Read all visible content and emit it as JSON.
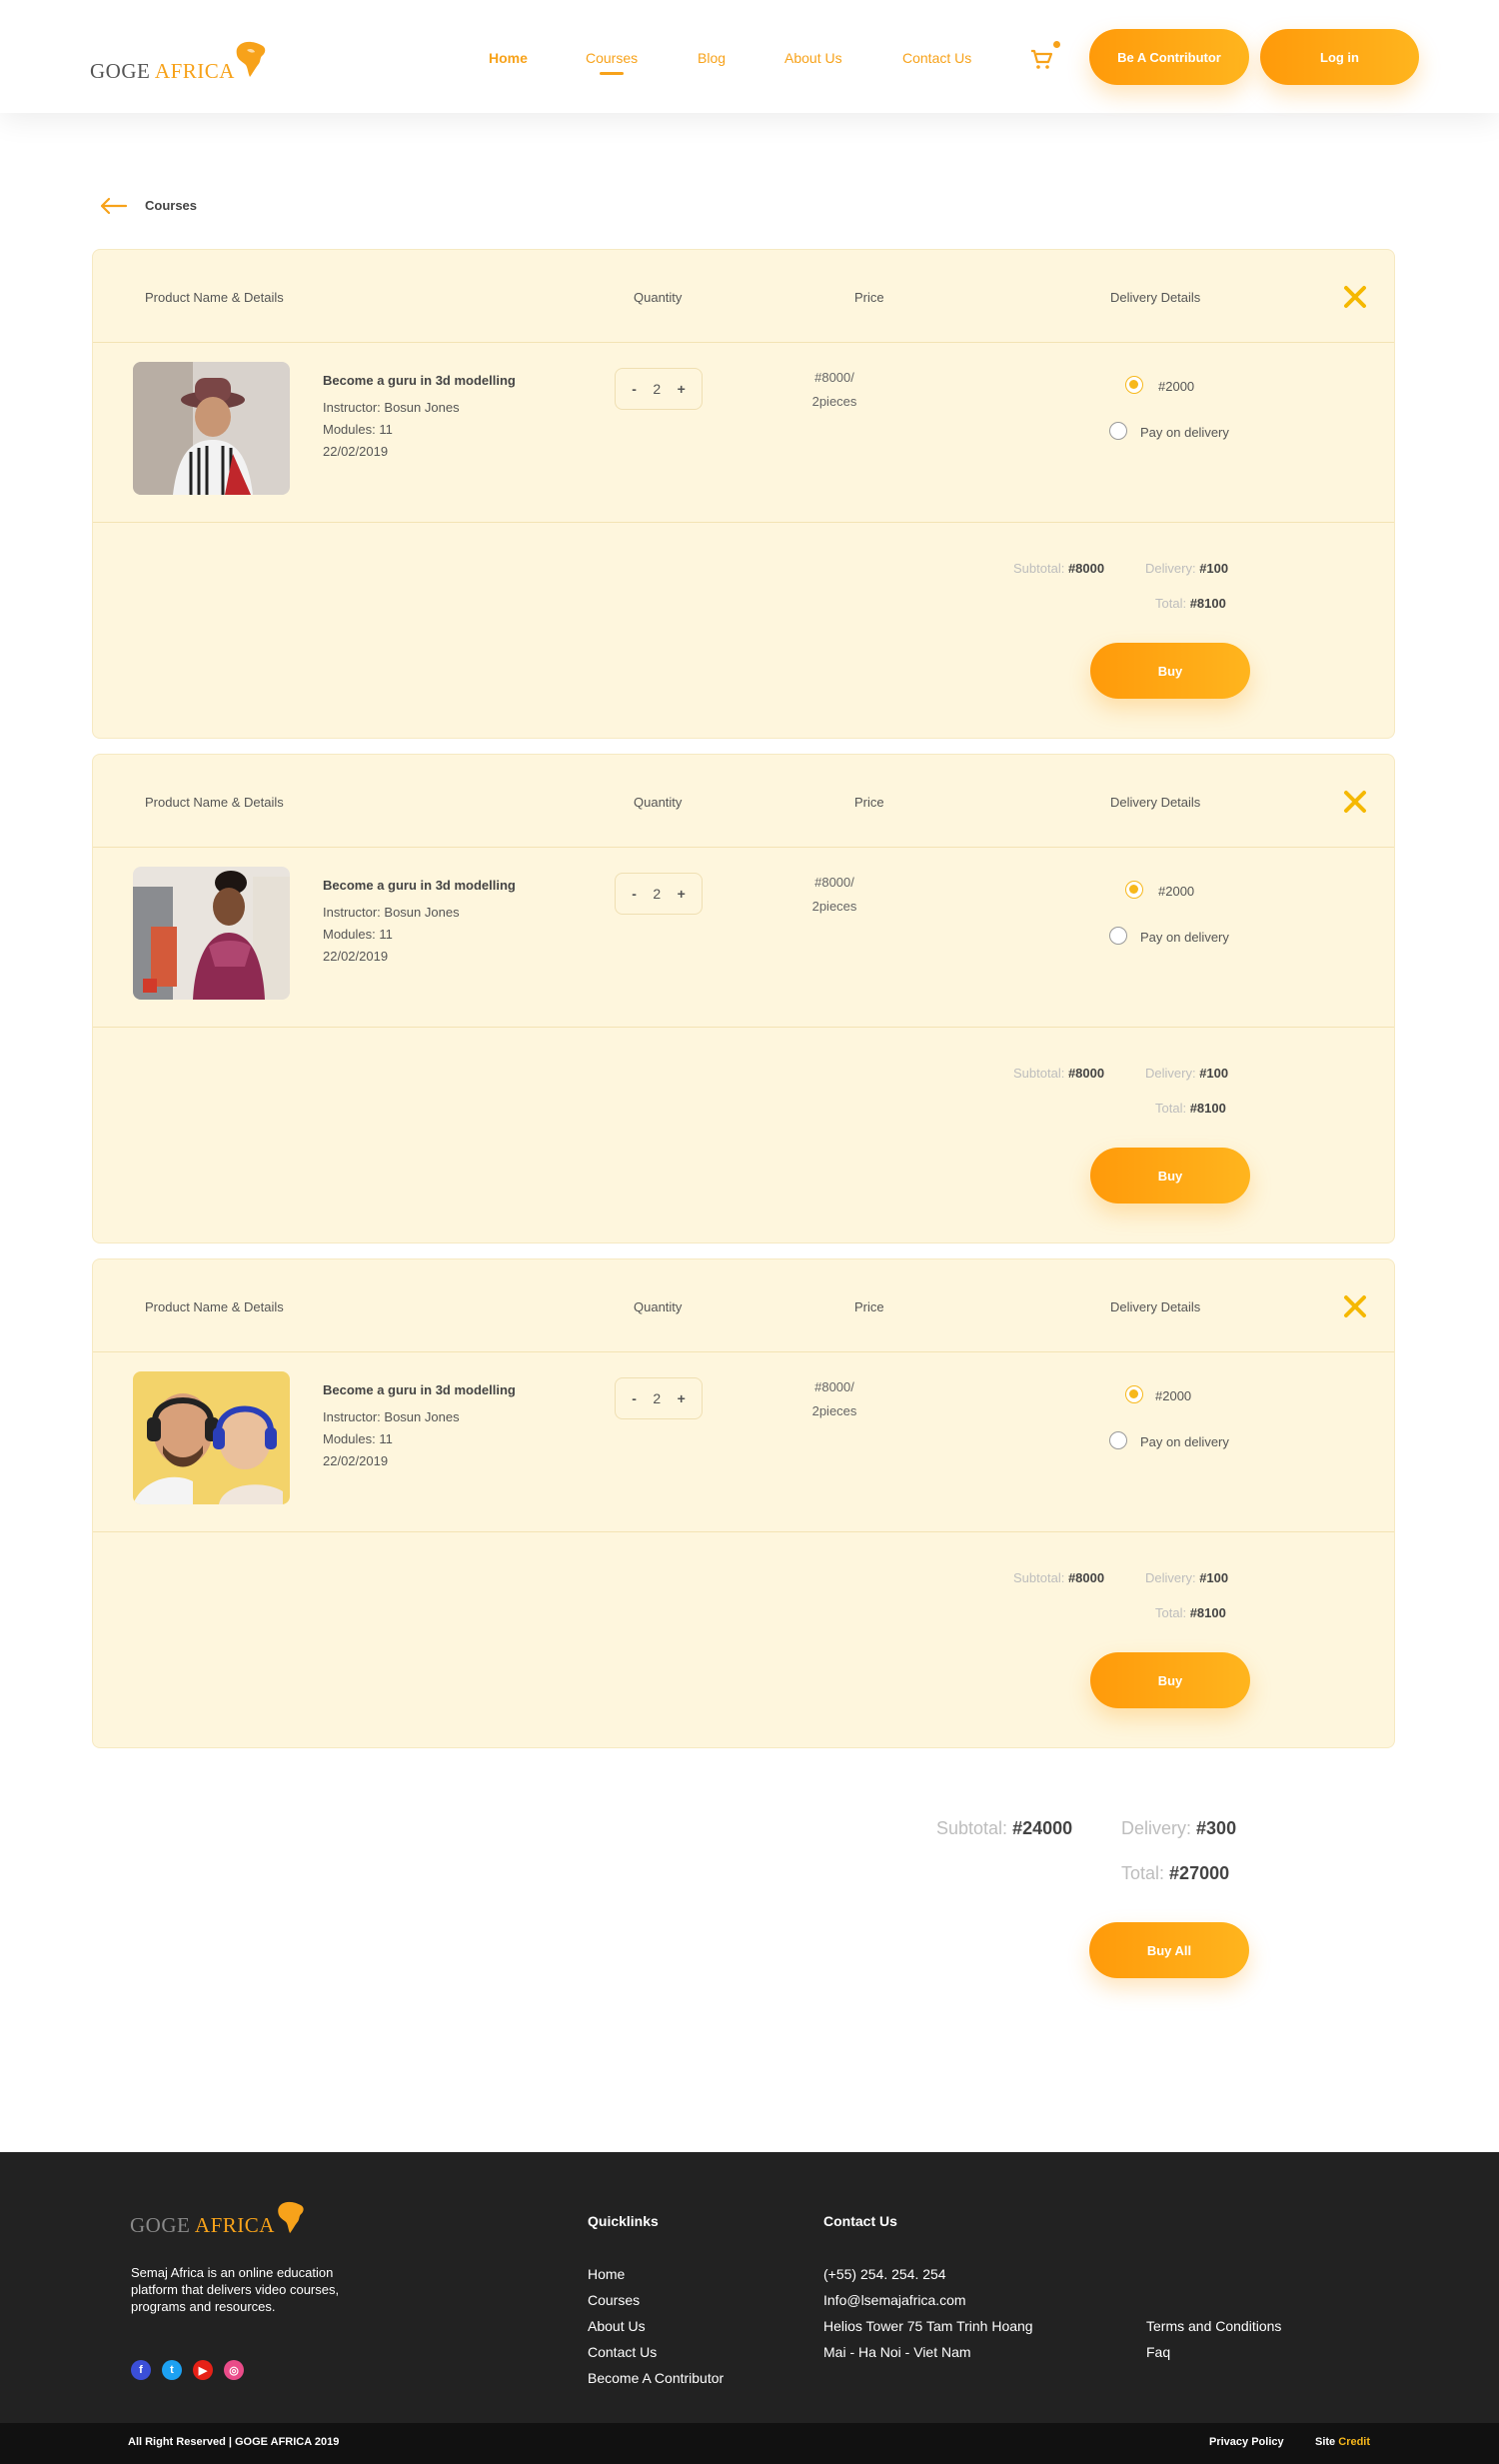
{
  "brand": {
    "name_part1": "GOGE",
    "name_part2": "AFRICA"
  },
  "nav": {
    "home": "Home",
    "courses": "Courses",
    "blog": "Blog",
    "about": "About Us",
    "contact": "Contact Us",
    "contributor_btn": "Be A Contributor",
    "login_btn": "Log in"
  },
  "breadcrumb": {
    "label": "Courses"
  },
  "table_headers": {
    "product": "Product Name & Details",
    "quantity": "Quantity",
    "price": "Price",
    "delivery": "Delivery Details"
  },
  "cart_items": [
    {
      "title": "Become a guru in 3d modelling",
      "instructor": "Instructor: Bosun Jones",
      "modules": "Modules: 11",
      "date": "22/02/2019",
      "qty_minus": "-",
      "qty": "2",
      "qty_plus": "+",
      "price_line1": "#8000/",
      "price_line2": "2pieces",
      "delivery_option1": "#2000",
      "delivery_option2": "Pay on delivery",
      "subtotal_label": "Subtotal:",
      "subtotal": "#8000",
      "delivery_label": "Delivery:",
      "delivery": "#100",
      "total_label": "Total:",
      "total": "#8100",
      "buy": "Buy"
    },
    {
      "title": "Become a guru in 3d modelling",
      "instructor": "Instructor: Bosun Jones",
      "modules": "Modules: 11",
      "date": "22/02/2019",
      "qty_minus": "-",
      "qty": "2",
      "qty_plus": "+",
      "price_line1": "#8000/",
      "price_line2": "2pieces",
      "delivery_option1": "#2000",
      "delivery_option2": "Pay on delivery",
      "subtotal_label": "Subtotal:",
      "subtotal": "#8000",
      "delivery_label": "Delivery:",
      "delivery": "#100",
      "total_label": "Total:",
      "total": "#8100",
      "buy": "Buy"
    },
    {
      "title": "Become a guru in 3d modelling",
      "instructor": "Instructor: Bosun Jones",
      "modules": "Modules: 11",
      "date": "22/02/2019",
      "qty_minus": "-",
      "qty": "2",
      "qty_plus": "+",
      "price_line1": "#8000/",
      "price_line2": "2pieces",
      "delivery_option1": "#2000",
      "delivery_option2": "Pay on delivery",
      "subtotal_label": "Subtotal:",
      "subtotal": "#8000",
      "delivery_label": "Delivery:",
      "delivery": "#100",
      "total_label": "Total:",
      "total": "#8100",
      "buy": "Buy"
    }
  ],
  "summary": {
    "subtotal_label": "Subtotal:",
    "subtotal": "#24000",
    "delivery_label": "Delivery:",
    "delivery": "#300",
    "total_label": "Total:",
    "total": "#27000",
    "buy_all": "Buy All"
  },
  "footer": {
    "description": "Semaj Africa is an online education platform that delivers video courses, programs and resources.",
    "social": [
      "facebook-icon",
      "twitter-icon",
      "youtube-icon",
      "dribbble-icon"
    ],
    "quicklinks_heading": "Quicklinks",
    "quicklinks": [
      "Home",
      "Courses",
      "About Us",
      "Contact Us",
      "Become A Contributor"
    ],
    "contact_heading": "Contact Us",
    "contact": [
      "(+55) 254. 254. 254",
      "Info@lsemajafrica.com",
      "Helios Tower 75 Tam Trinh Hoang",
      "Mai - Ha Noi - Viet Nam"
    ],
    "legal": [
      "Terms and Conditions",
      "Faq"
    ],
    "copyright": "All Right Reserved | GOGE AFRICA 2019",
    "privacy": "Privacy Policy",
    "site_label": "Site",
    "credit": "Credit"
  },
  "colors": {
    "accent": "#f7a21a",
    "card_bg": "#fef6dd",
    "footer_bg": "#222222"
  }
}
